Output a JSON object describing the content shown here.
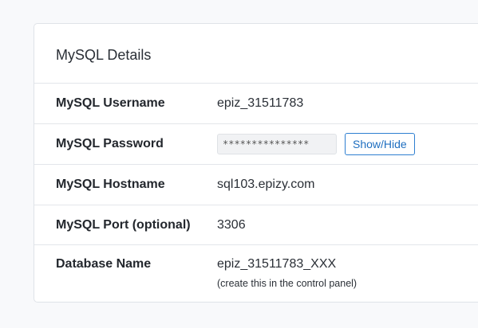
{
  "card": {
    "title": "MySQL Details"
  },
  "rows": [
    {
      "label": "MySQL Username",
      "value": "epiz_31511783"
    },
    {
      "label": "MySQL Password",
      "value": "***************",
      "button": "Show/Hide"
    },
    {
      "label": "MySQL Hostname",
      "value": "sql103.epizy.com"
    },
    {
      "label": "MySQL Port (optional)",
      "value": "3306"
    },
    {
      "label": "Database Name",
      "value": "epiz_31511783_XXX",
      "note": "(create this in the control panel)"
    }
  ]
}
